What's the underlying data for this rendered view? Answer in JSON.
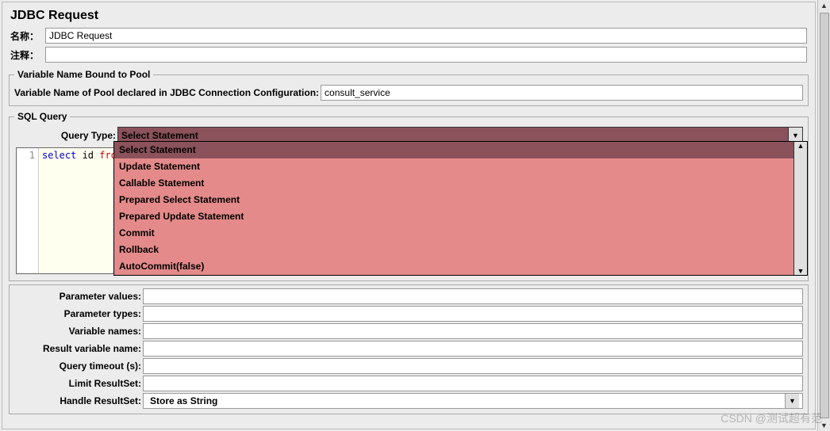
{
  "header": {
    "title": "JDBC Request"
  },
  "general": {
    "name_label": "名称：",
    "name_value": "JDBC Request",
    "comment_label": "注释：",
    "comment_value": ""
  },
  "pool": {
    "legend": "Variable Name Bound to Pool",
    "label": "Variable Name of Pool declared in JDBC Connection Configuration:",
    "value": "consult_service"
  },
  "sql": {
    "legend": "SQL Query",
    "query_type_label": "Query Type:",
    "query_type_value": "Select Statement",
    "options": [
      "Select Statement",
      "Update Statement",
      "Callable Statement",
      "Prepared Select Statement",
      "Prepared Update Statement",
      "Commit",
      "Rollback",
      "AutoCommit(false)"
    ],
    "code_line_number": "1",
    "code_tokens": {
      "t1": "select",
      "t2": " id ",
      "t3": "from"
    }
  },
  "params": {
    "parameter_values": {
      "label": "Parameter values:",
      "value": ""
    },
    "parameter_types": {
      "label": "Parameter types:",
      "value": ""
    },
    "variable_names": {
      "label": "Variable names:",
      "value": ""
    },
    "result_variable": {
      "label": "Result variable name:",
      "value": ""
    },
    "query_timeout": {
      "label": "Query timeout (s):",
      "value": ""
    },
    "limit_resultset": {
      "label": "Limit ResultSet:",
      "value": ""
    },
    "handle_resultset": {
      "label": "Handle ResultSet:",
      "value": "Store as String"
    }
  },
  "watermark": "CSDN @测试超有范"
}
